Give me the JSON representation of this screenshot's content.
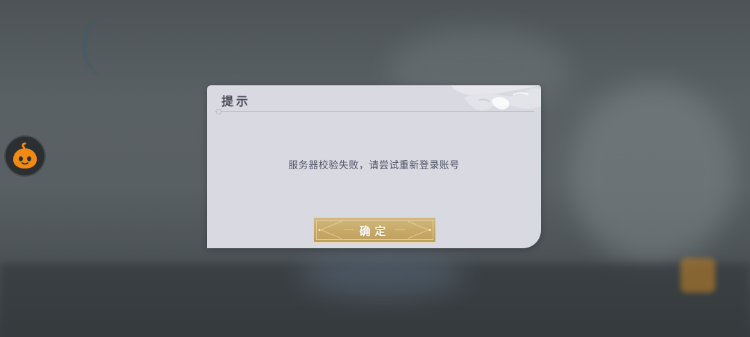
{
  "floating_button": {
    "icon": "orange-mascot-icon"
  },
  "dialog": {
    "title": "提示",
    "message": "服务器校验失败，请尝试重新登录账号",
    "confirm_label": "确定"
  },
  "colors": {
    "dialog_background": "#d9d9e1",
    "title_text": "#4b4e5d",
    "message_text": "#4f5366",
    "button_gold": "#c8aa68",
    "mascot_orange": "#f08a12"
  }
}
